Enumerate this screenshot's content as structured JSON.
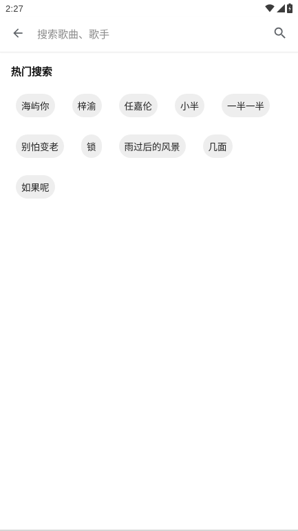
{
  "status_bar": {
    "time": "2:27",
    "icons": [
      "wifi-icon",
      "cell-signal-icon",
      "battery-icon"
    ]
  },
  "search": {
    "placeholder": "搜索歌曲、歌手",
    "value": ""
  },
  "hot_search": {
    "title": "热门搜索",
    "items": [
      "海屿你",
      "梓渝",
      "任嘉伦",
      "小半",
      "一半一半",
      "别怕变老",
      "锁",
      "雨过后的风景",
      "几面",
      "如果呢"
    ]
  },
  "colors": {
    "chip_bg": "#eeeeee",
    "icon": "#5f6368",
    "title_text": "#111111",
    "placeholder": "#8a8a8a"
  }
}
